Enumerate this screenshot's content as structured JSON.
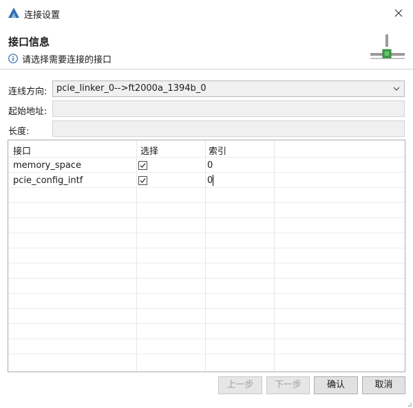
{
  "window": {
    "title": "连接设置"
  },
  "header": {
    "title": "接口信息",
    "description": "请选择需要连接的接口",
    "info_icon": "info-icon",
    "banner_icon": "connector-icon"
  },
  "form": {
    "direction_label": "连线方向:",
    "direction_value": "pcie_linker_0-->ft2000a_1394b_0",
    "start_address_label": "起始地址:",
    "start_address_value": "",
    "length_label": "长度:",
    "length_value": ""
  },
  "table": {
    "columns": [
      "接口",
      "选择",
      "索引"
    ],
    "rows": [
      {
        "interface": "memory_space",
        "selected": true,
        "index": "0"
      },
      {
        "interface": "pcie_config_intf",
        "selected": true,
        "index": "0"
      }
    ]
  },
  "buttons": {
    "prev": "上一步",
    "next": "下一步",
    "ok": "确认",
    "cancel": "取消"
  },
  "colors": {
    "accent": "#2f6fb4",
    "banner_green": "#3aa047"
  }
}
